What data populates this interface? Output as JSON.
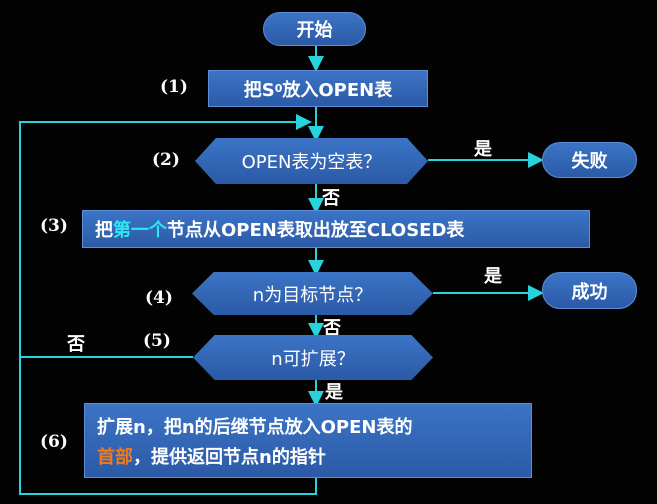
{
  "start": "开始",
  "steps": {
    "s1": "(1)",
    "s2": "(2)",
    "s3": "(3)",
    "s4": "(4)",
    "s5": "(5)",
    "s6": "(6)"
  },
  "box1": {
    "pre": "把S",
    "sub": "0",
    "post": "放入OPEN表"
  },
  "diamond2": "OPEN表为空表？",
  "box3": {
    "pre": "把",
    "highlight": "第一个",
    "post": "节点从OPEN表取出放至CLOSED表"
  },
  "diamond4": "n为目标节点？",
  "diamond5": "n可扩展？",
  "box6": {
    "line1": "扩展n，把n的后继节点放入OPEN表的",
    "highlight": "首部",
    "line2_post": "，提供返回节点n的指针"
  },
  "fail": "失败",
  "success": "成功",
  "labels": {
    "yes1": "是",
    "no1": "否",
    "yes2": "是",
    "no2": "否",
    "no3": "否",
    "yes3": "是"
  },
  "colors": {
    "box_fill": "#3066b8",
    "arrow": "#27d3dc",
    "highlight": "#2fe6f0",
    "accent_orange": "#f07a1e"
  }
}
